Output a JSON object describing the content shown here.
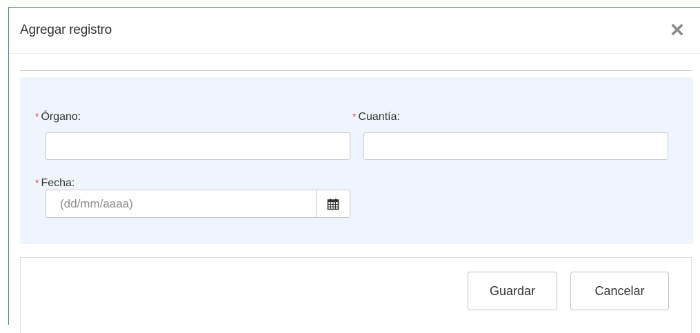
{
  "modal": {
    "title": "Agregar registro",
    "close_icon": "close-icon"
  },
  "form": {
    "required_mark": "*",
    "organo": {
      "label": "Órgano:",
      "value": ""
    },
    "cuantia": {
      "label": "Cuantía:",
      "value": ""
    },
    "fecha": {
      "label": "Fecha:",
      "value": "",
      "placeholder": "(dd/mm/aaaa)",
      "icon": "calendar-icon"
    }
  },
  "footer": {
    "save_label": "Guardar",
    "cancel_label": "Cancelar"
  },
  "colors": {
    "accent_border": "#4a79b0",
    "panel_bg": "#f0f5fd",
    "required": "#d9534f"
  }
}
